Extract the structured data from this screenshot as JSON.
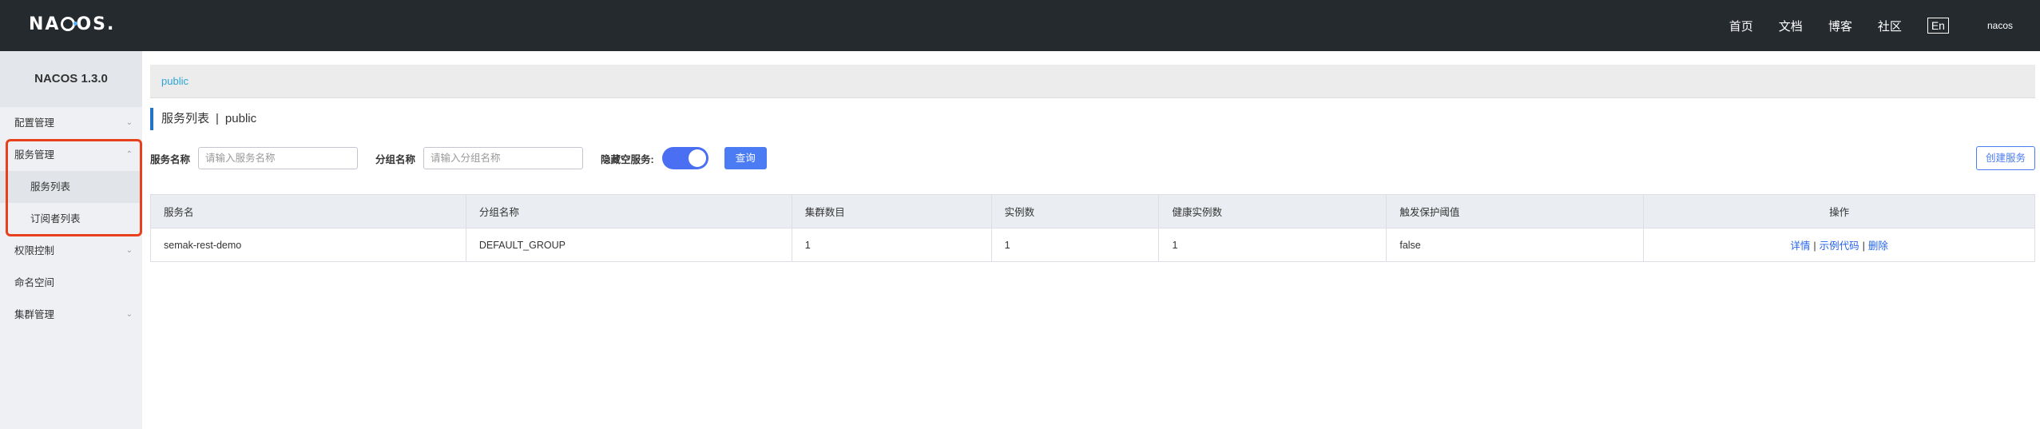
{
  "header": {
    "logo_text": "NACOS",
    "nav": [
      "首页",
      "文档",
      "博客",
      "社区"
    ],
    "lang": "En",
    "user": "nacos"
  },
  "sidebar": {
    "title": "NACOS 1.3.0",
    "items": [
      {
        "label": "配置管理"
      },
      {
        "label": "服务管理"
      },
      {
        "label": "服务列表"
      },
      {
        "label": "订阅者列表"
      },
      {
        "label": "权限控制"
      },
      {
        "label": "命名空间"
      },
      {
        "label": "集群管理"
      }
    ]
  },
  "namespace": "public",
  "page": {
    "title": "服务列表",
    "sep": "|",
    "namespace": "public"
  },
  "filters": {
    "service_label": "服务名称",
    "service_placeholder": "请输入服务名称",
    "group_label": "分组名称",
    "group_placeholder": "请输入分组名称",
    "hide_empty_label": "隐藏空服务:",
    "hide_empty_on": true,
    "query_button": "查询",
    "create_button": "创建服务"
  },
  "table": {
    "columns": [
      "服务名",
      "分组名称",
      "集群数目",
      "实例数",
      "健康实例数",
      "触发保护阈值",
      "操作"
    ],
    "rows": [
      {
        "service": "semak-rest-demo",
        "group": "DEFAULT_GROUP",
        "clusters": "1",
        "instances": "1",
        "healthy": "1",
        "threshold": "false",
        "ops": [
          "详情",
          "示例代码",
          "删除"
        ]
      }
    ]
  },
  "colors": {
    "topbar": "#252a2f",
    "accent": "#4b7cf3",
    "highlight": "#e8401c"
  }
}
